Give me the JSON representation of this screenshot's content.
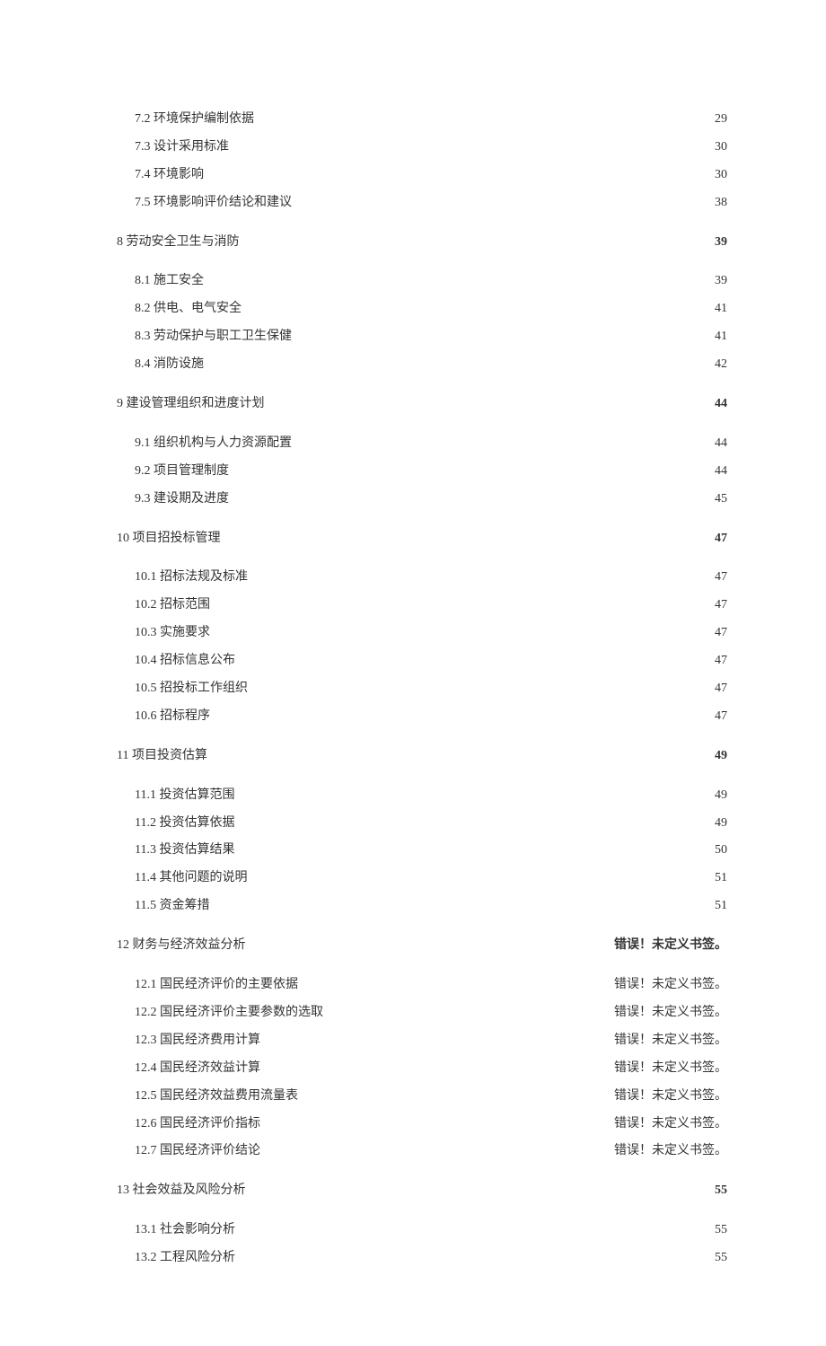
{
  "toc": [
    {
      "level": 2,
      "label": "7.2 环境保护编制依据",
      "page": "29"
    },
    {
      "level": 2,
      "label": "7.3 设计采用标准",
      "page": "30"
    },
    {
      "level": 2,
      "label": "7.4 环境影响",
      "page": "30"
    },
    {
      "level": 2,
      "label": "7.5 环境影响评价结论和建议",
      "page": "38"
    },
    {
      "level": 1,
      "label": "8 劳动安全卫生与消防",
      "page": "39"
    },
    {
      "level": 2,
      "label": "8.1 施工安全",
      "page": "39"
    },
    {
      "level": 2,
      "label": "8.2 供电、电气安全",
      "page": "41"
    },
    {
      "level": 2,
      "label": "8.3 劳动保护与职工卫生保健",
      "page": "41"
    },
    {
      "level": 2,
      "label": "8.4 消防设施",
      "page": "42"
    },
    {
      "level": 1,
      "label": "9 建设管理组织和进度计划",
      "page": "44"
    },
    {
      "level": 2,
      "label": "9.1 组织机构与人力资源配置",
      "page": "44"
    },
    {
      "level": 2,
      "label": "9.2 项目管理制度",
      "page": "44"
    },
    {
      "level": 2,
      "label": "9.3 建设期及进度",
      "page": "45"
    },
    {
      "level": 1,
      "label": "10 项目招投标管理",
      "page": "47"
    },
    {
      "level": 2,
      "label": "10.1  招标法规及标准",
      "page": "47"
    },
    {
      "level": 2,
      "label": "10.2 招标范围",
      "page": "47"
    },
    {
      "level": 2,
      "label": "10.3 实施要求",
      "page": "47"
    },
    {
      "level": 2,
      "label": "10.4 招标信息公布",
      "page": "47"
    },
    {
      "level": 2,
      "label": "10.5 招投标工作组织",
      "page": "47"
    },
    {
      "level": 2,
      "label": "10.6 招标程序",
      "page": "47"
    },
    {
      "level": 1,
      "label": "11 项目投资估算",
      "page": "49"
    },
    {
      "level": 2,
      "label": "11.1 投资估算范围",
      "page": "49"
    },
    {
      "level": 2,
      "label": "11.2  投资估算依据",
      "page": "49"
    },
    {
      "level": 2,
      "label": "11.3 投资估算结果",
      "page": "50"
    },
    {
      "level": 2,
      "label": "11.4 其他问题的说明",
      "page": "51"
    },
    {
      "level": 2,
      "label": "11.5 资金筹措",
      "page": "51"
    },
    {
      "level": 1,
      "label": "12 财务与经济效益分析",
      "page": "错误！未定义书签。"
    },
    {
      "level": 2,
      "label": "12.1 国民经济评价的主要依据",
      "page": "错误！未定义书签。"
    },
    {
      "level": 2,
      "label": "12.2 国民经济评价主要参数的选取",
      "page": "错误！未定义书签。"
    },
    {
      "level": 2,
      "label": "12.3 国民经济费用计算",
      "page": "错误！未定义书签。"
    },
    {
      "level": 2,
      "label": "12.4 国民经济效益计算",
      "page": "错误！未定义书签。"
    },
    {
      "level": 2,
      "label": "12.5 国民经济效益费用流量表",
      "page": "错误！未定义书签。"
    },
    {
      "level": 2,
      "label": "12.6 国民经济评价指标",
      "page": "错误！未定义书签。"
    },
    {
      "level": 2,
      "label": "12.7 国民经济评价结论",
      "page": "错误！未定义书签。"
    },
    {
      "level": 1,
      "label": "13 社会效益及风险分析",
      "page": "55"
    },
    {
      "level": 2,
      "label": "13.1 社会影响分析",
      "page": "55"
    },
    {
      "level": 2,
      "label": "13.2 工程风险分析",
      "page": "55"
    }
  ]
}
